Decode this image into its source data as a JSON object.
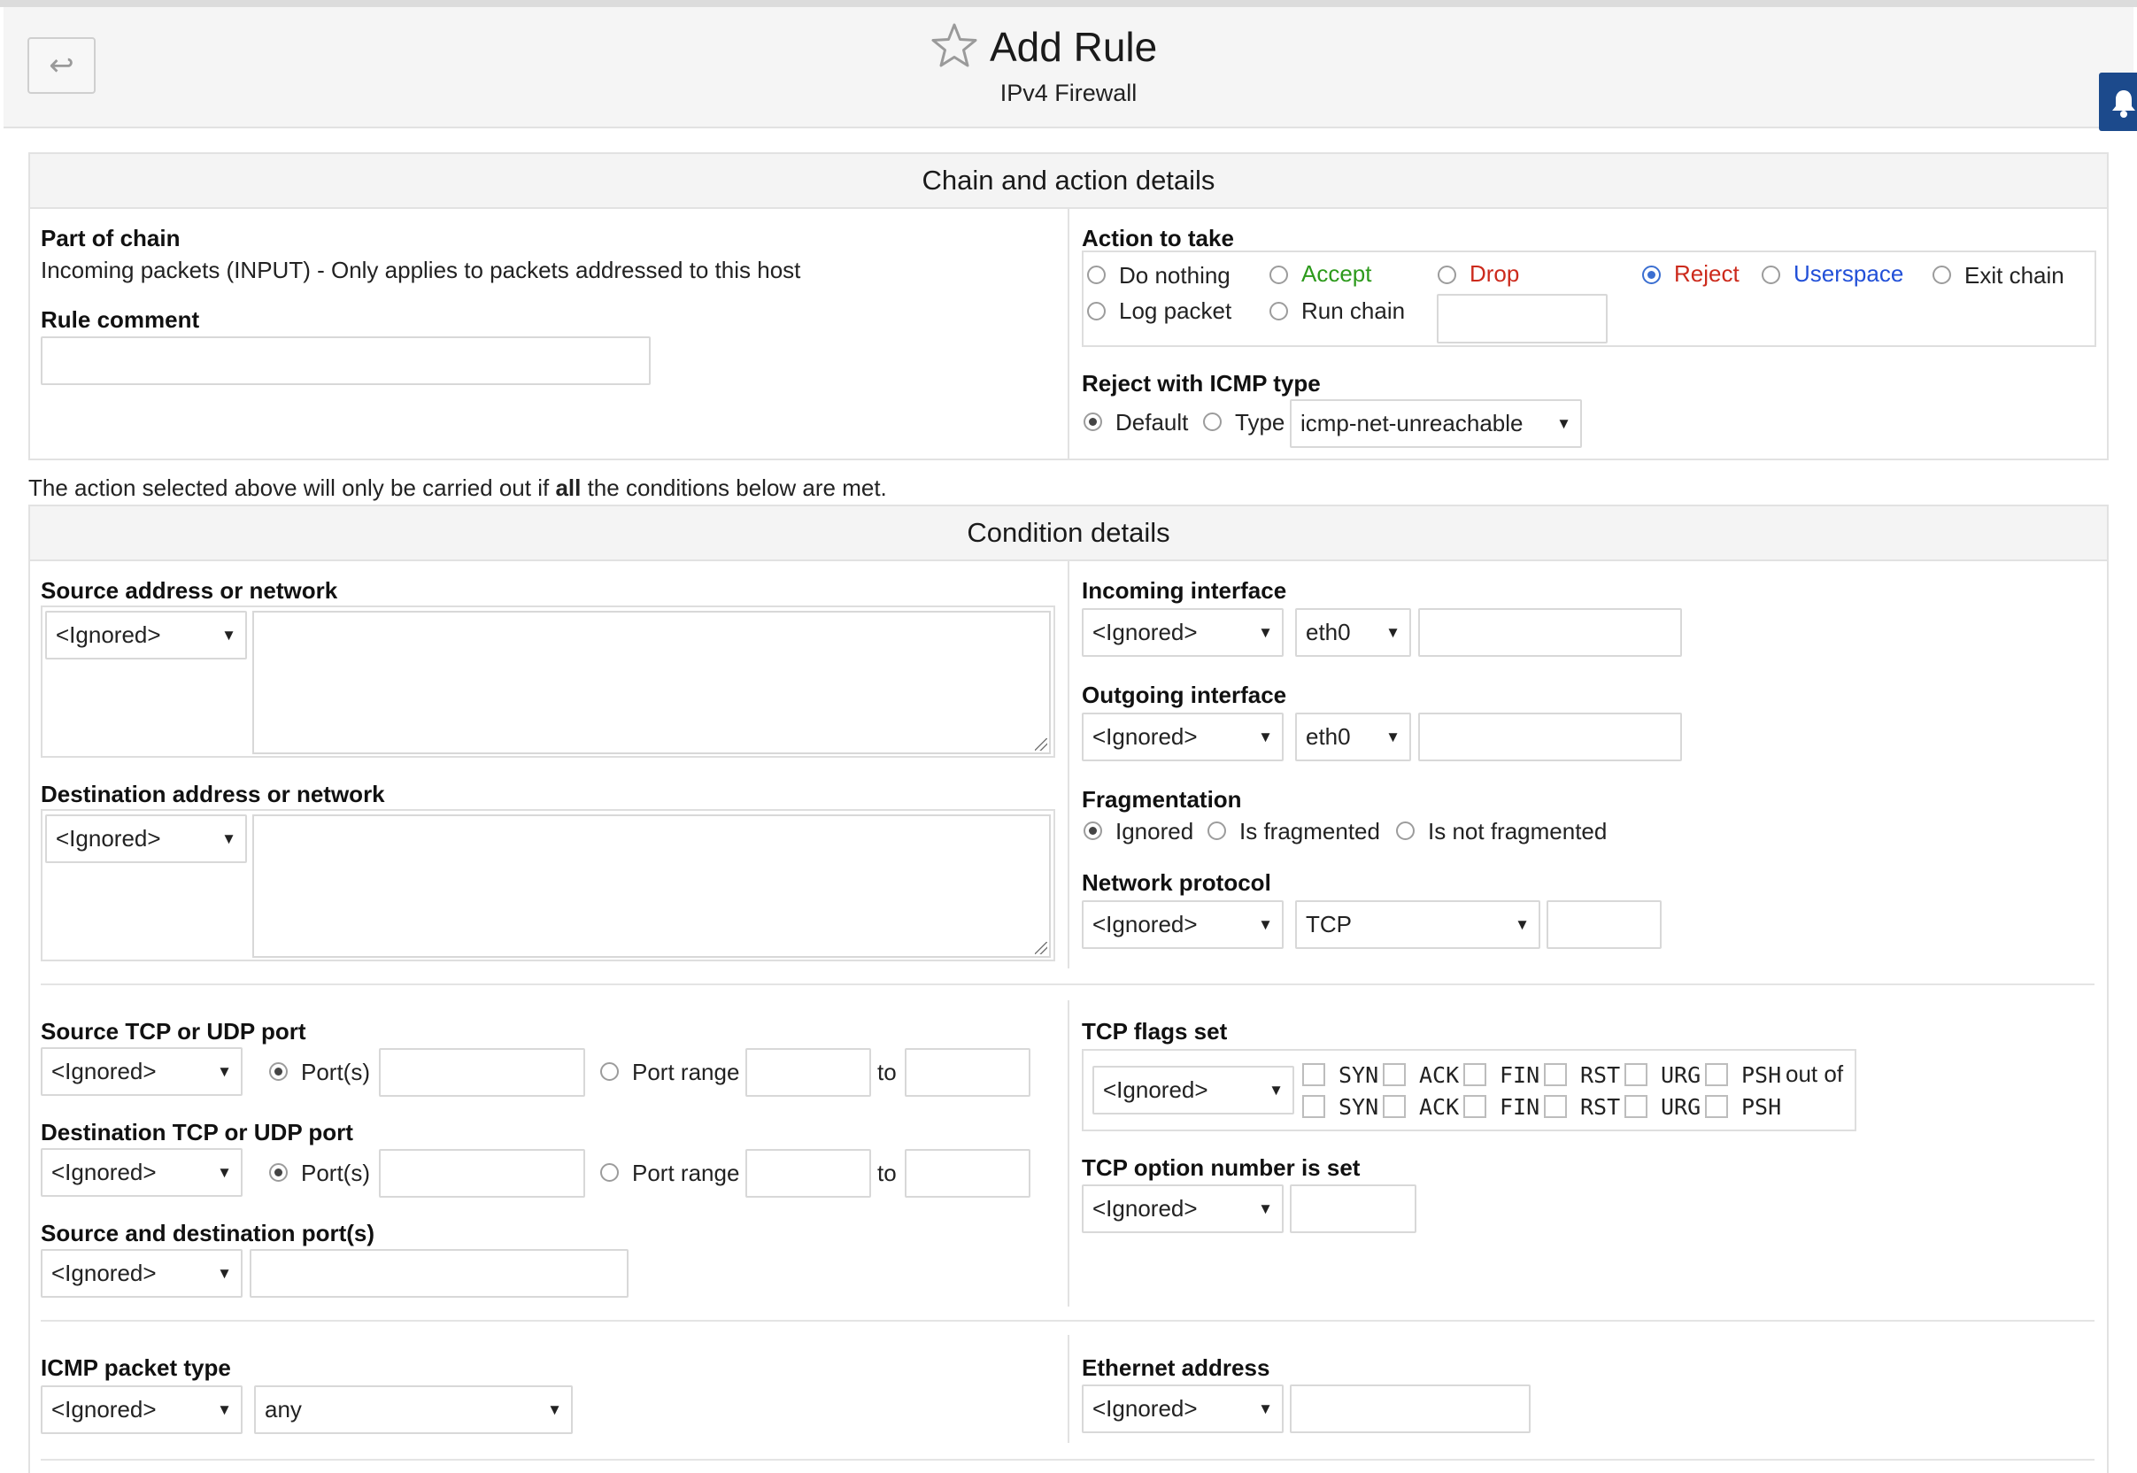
{
  "header": {
    "back_icon": "↩",
    "title": "Add Rule",
    "subtitle": "IPv4 Firewall"
  },
  "chain_panel": {
    "heading": "Chain and action details",
    "part_of_chain_label": "Part of chain",
    "part_of_chain_value": "Incoming packets (INPUT) - Only applies to packets addressed to this host",
    "rule_comment_label": "Rule comment",
    "rule_comment_value": "",
    "action_label": "Action to take",
    "actions": {
      "do_nothing": "Do nothing",
      "accept": "Accept",
      "drop": "Drop",
      "reject": "Reject",
      "userspace": "Userspace",
      "exit_chain": "Exit chain",
      "log_packet": "Log packet",
      "run_chain": "Run chain"
    },
    "selected_action": "Reject",
    "run_chain_value": "",
    "reject_label": "Reject with ICMP type",
    "reject_default": "Default",
    "reject_type": "Type",
    "reject_type_value": "icmp-net-unreachable"
  },
  "notice": {
    "before": "The action selected above will only be carried out if ",
    "bold": "all",
    "after": " the conditions below are met."
  },
  "condition_panel": {
    "heading": "Condition details",
    "source_address": {
      "label": "Source address or network",
      "mode": "<Ignored>",
      "value": ""
    },
    "destination_address": {
      "label": "Destination address or network",
      "mode": "<Ignored>",
      "value": ""
    },
    "incoming_interface": {
      "label": "Incoming interface",
      "mode": "<Ignored>",
      "iface": "eth0",
      "value": ""
    },
    "outgoing_interface": {
      "label": "Outgoing interface",
      "mode": "<Ignored>",
      "iface": "eth0",
      "value": ""
    },
    "fragmentation": {
      "label": "Fragmentation",
      "ignored": "Ignored",
      "is_fragmented": "Is fragmented",
      "is_not_fragmented": "Is not fragmented",
      "selected": "Ignored"
    },
    "network_protocol": {
      "label": "Network protocol",
      "mode": "<Ignored>",
      "protocol": "TCP",
      "value": ""
    },
    "source_port": {
      "label": "Source TCP or UDP port",
      "mode": "<Ignored>",
      "ports_label": "Port(s)",
      "range_label": "Port range",
      "to_label": "to"
    },
    "destination_port": {
      "label": "Destination TCP or UDP port",
      "mode": "<Ignored>",
      "ports_label": "Port(s)",
      "range_label": "Port range",
      "to_label": "to"
    },
    "src_dst_ports": {
      "label": "Source and destination port(s)",
      "mode": "<Ignored>",
      "value": ""
    },
    "tcp_flags": {
      "label": "TCP flags set",
      "mode": "<Ignored>",
      "flags": [
        "SYN",
        "ACK",
        "FIN",
        "RST",
        "URG",
        "PSH"
      ],
      "out_of": "out of"
    },
    "tcp_option": {
      "label": "TCP option number is set",
      "mode": "<Ignored>",
      "value": ""
    },
    "icmp_type": {
      "label": "ICMP packet type",
      "mode": "<Ignored>",
      "type": "any"
    },
    "ethernet_address": {
      "label": "Ethernet address",
      "mode": "<Ignored>",
      "value": ""
    }
  },
  "colors": {
    "accept": "#2d9a1c",
    "drop": "#cc2a1c",
    "reject": "#cc2a1c",
    "userspace": "#2250d8",
    "bell_tab": "#1c4a8c"
  },
  "icons": {
    "back": "back-arrow-icon",
    "star": "star-outline-icon",
    "bell": "bell-icon",
    "dropdown": "triangle-down-icon"
  }
}
